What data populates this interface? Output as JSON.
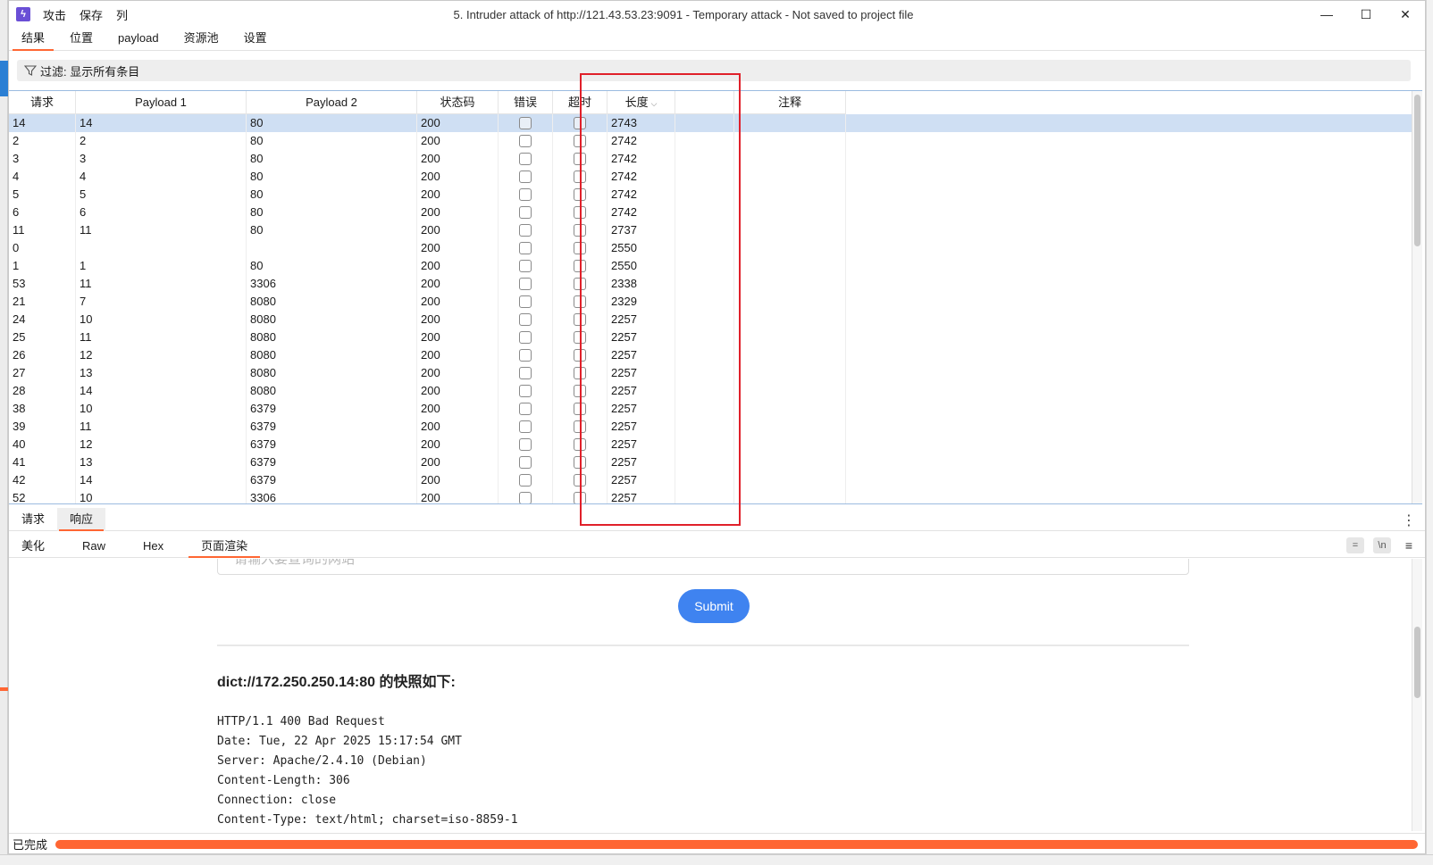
{
  "window": {
    "title": "5. Intruder attack of http://121.43.53.23:9091 - Temporary attack - Not saved to project file",
    "menu": [
      "攻击",
      "保存",
      "列"
    ],
    "controls": {
      "minimize": "—",
      "maximize": "☐",
      "close": "✕"
    }
  },
  "top_tabs": [
    "结果",
    "位置",
    "payload",
    "资源池",
    "设置"
  ],
  "filter": {
    "label": "过滤: 显示所有条目"
  },
  "table": {
    "columns": [
      "请求",
      "Payload 1",
      "Payload 2",
      "状态码",
      "错误",
      "超时",
      "长度",
      "",
      "注释"
    ],
    "sort_indicator": "⌵",
    "rows": [
      {
        "req": "14",
        "p1": "14",
        "p2": "80",
        "status": "200",
        "length": "2743"
      },
      {
        "req": "2",
        "p1": "2",
        "p2": "80",
        "status": "200",
        "length": "2742"
      },
      {
        "req": "3",
        "p1": "3",
        "p2": "80",
        "status": "200",
        "length": "2742"
      },
      {
        "req": "4",
        "p1": "4",
        "p2": "80",
        "status": "200",
        "length": "2742"
      },
      {
        "req": "5",
        "p1": "5",
        "p2": "80",
        "status": "200",
        "length": "2742"
      },
      {
        "req": "6",
        "p1": "6",
        "p2": "80",
        "status": "200",
        "length": "2742"
      },
      {
        "req": "11",
        "p1": "11",
        "p2": "80",
        "status": "200",
        "length": "2737"
      },
      {
        "req": "0",
        "p1": "",
        "p2": "",
        "status": "200",
        "length": "2550"
      },
      {
        "req": "1",
        "p1": "1",
        "p2": "80",
        "status": "200",
        "length": "2550"
      },
      {
        "req": "53",
        "p1": "11",
        "p2": "3306",
        "status": "200",
        "length": "2338"
      },
      {
        "req": "21",
        "p1": "7",
        "p2": "8080",
        "status": "200",
        "length": "2329"
      },
      {
        "req": "24",
        "p1": "10",
        "p2": "8080",
        "status": "200",
        "length": "2257"
      },
      {
        "req": "25",
        "p1": "11",
        "p2": "8080",
        "status": "200",
        "length": "2257"
      },
      {
        "req": "26",
        "p1": "12",
        "p2": "8080",
        "status": "200",
        "length": "2257"
      },
      {
        "req": "27",
        "p1": "13",
        "p2": "8080",
        "status": "200",
        "length": "2257"
      },
      {
        "req": "28",
        "p1": "14",
        "p2": "8080",
        "status": "200",
        "length": "2257"
      },
      {
        "req": "38",
        "p1": "10",
        "p2": "6379",
        "status": "200",
        "length": "2257"
      },
      {
        "req": "39",
        "p1": "11",
        "p2": "6379",
        "status": "200",
        "length": "2257"
      },
      {
        "req": "40",
        "p1": "12",
        "p2": "6379",
        "status": "200",
        "length": "2257"
      },
      {
        "req": "41",
        "p1": "13",
        "p2": "6379",
        "status": "200",
        "length": "2257"
      },
      {
        "req": "42",
        "p1": "14",
        "p2": "6379",
        "status": "200",
        "length": "2257"
      },
      {
        "req": "52",
        "p1": "10",
        "p2": "3306",
        "status": "200",
        "length": "2257"
      }
    ]
  },
  "rr_tabs": [
    "请求",
    "响应"
  ],
  "view_tabs": [
    "美化",
    "Raw",
    "Hex",
    "页面渲染"
  ],
  "view_icons": [
    "=",
    "\\n",
    "≡"
  ],
  "render": {
    "input_placeholder": "请输入要查询的网站",
    "submit_label": "Submit",
    "snapshot_title": "dict://172.250.250.14:80 的快照如下:",
    "response_lines": [
      "HTTP/1.1 400 Bad Request",
      "Date: Tue, 22 Apr 2025 15:17:54 GMT",
      "Server: Apache/2.4.10 (Debian)",
      "Content-Length: 306",
      "Connection: close",
      "Content-Type: text/html; charset=iso-8859-1"
    ]
  },
  "status": {
    "text": "已完成",
    "progress": 1.0
  },
  "colors": {
    "accent": "#ff6633",
    "selection": "#cfdff3",
    "annotation": "#e0202a",
    "submit": "#3f83f0"
  }
}
